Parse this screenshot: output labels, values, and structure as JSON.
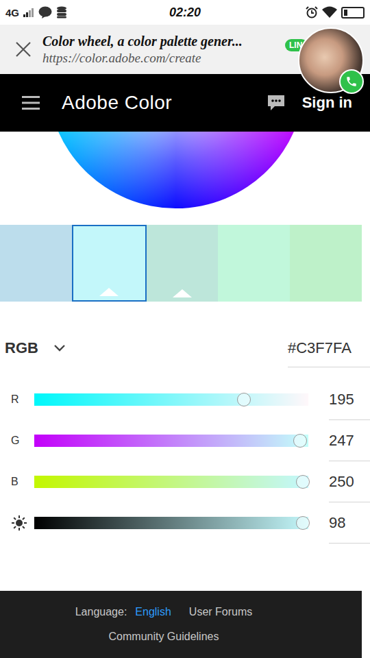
{
  "status_bar": {
    "network": "4G",
    "time": "02:20",
    "battery_level": 0.2
  },
  "browser": {
    "title": "Color wheel, a color palette gener...",
    "url": "https://color.adobe.com/create",
    "chat_badge": "LIN"
  },
  "header": {
    "title": "Adobe Color",
    "action": "Sign in"
  },
  "swatches": [
    {
      "color": "#BCDDEC",
      "selected": false,
      "marker": false
    },
    {
      "color": "#C3F7FA",
      "selected": true,
      "marker": true
    },
    {
      "color": "#BDE6DA",
      "selected": false,
      "marker": true
    },
    {
      "color": "#C1F7DB",
      "selected": false,
      "marker": false
    },
    {
      "color": "#BEF1C9",
      "selected": false,
      "marker": false
    }
  ],
  "mode": {
    "label": "RGB",
    "hex": "#C3F7FA"
  },
  "sliders": [
    {
      "kind": "channel",
      "label": "R",
      "value": "195",
      "level": 0.765
    },
    {
      "kind": "channel",
      "label": "G",
      "value": "247",
      "level": 0.969
    },
    {
      "kind": "channel",
      "label": "B",
      "value": "250",
      "level": 0.98
    },
    {
      "kind": "brightness",
      "label": "",
      "value": "98",
      "level": 0.98
    }
  ],
  "footer": {
    "language_label": "Language:",
    "language": "English",
    "links": [
      "User Forums",
      "Community Guidelines"
    ]
  }
}
